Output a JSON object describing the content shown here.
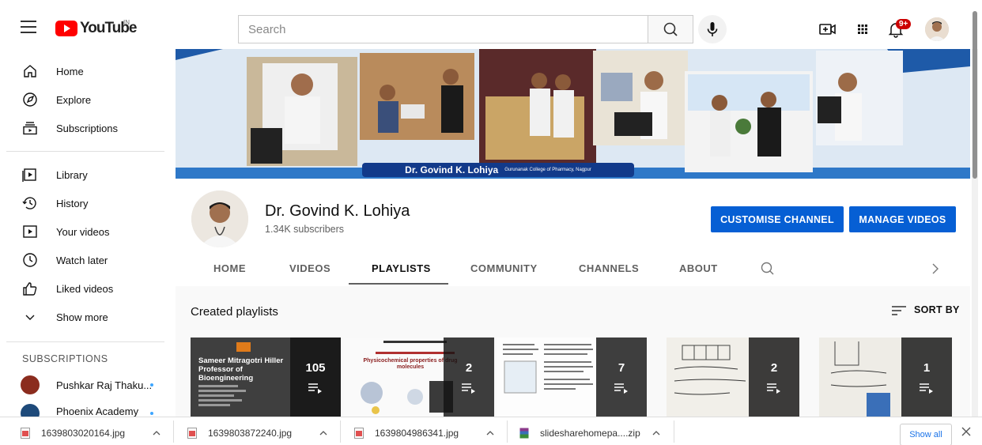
{
  "header": {
    "logo_text": "YouTube",
    "region": "IN",
    "search_placeholder": "Search",
    "notification_badge": "9+",
    "icons": [
      "menu-icon",
      "search-icon",
      "mic-icon",
      "create-video-icon",
      "apps-icon",
      "notifications-icon",
      "account-avatar"
    ]
  },
  "sidebar": {
    "main": [
      {
        "label": "Home",
        "icon": "home-icon"
      },
      {
        "label": "Explore",
        "icon": "explore-icon"
      },
      {
        "label": "Subscriptions",
        "icon": "subscriptions-icon"
      }
    ],
    "library": [
      {
        "label": "Library",
        "icon": "library-icon"
      },
      {
        "label": "History",
        "icon": "history-icon"
      },
      {
        "label": "Your videos",
        "icon": "your-videos-icon"
      },
      {
        "label": "Watch later",
        "icon": "watch-later-icon"
      },
      {
        "label": "Liked videos",
        "icon": "liked-videos-icon"
      },
      {
        "label": "Show more",
        "icon": "chevron-down-icon"
      }
    ],
    "subscriptions_heading": "SUBSCRIPTIONS",
    "subscriptions": [
      {
        "label": "Pushkar Raj Thaku...",
        "color": "#8b2c1e"
      },
      {
        "label": "Phoenix Academy",
        "color": "#1e4a7a"
      }
    ]
  },
  "banner": {
    "name": "Dr. Govind K. Lohiya",
    "sub": "Gurunanak College of Pharmacy, Nagpur"
  },
  "channel": {
    "name": "Dr. Govind K. Lohiya",
    "subscribers": "1.34K subscribers",
    "customise_label": "CUSTOMISE CHANNEL",
    "manage_label": "MANAGE VIDEOS",
    "accent": "#065fd4"
  },
  "tabs": [
    {
      "label": "HOME",
      "active": false
    },
    {
      "label": "VIDEOS",
      "active": false
    },
    {
      "label": "PLAYLISTS",
      "active": true
    },
    {
      "label": "COMMUNITY",
      "active": false
    },
    {
      "label": "CHANNELS",
      "active": false
    },
    {
      "label": "ABOUT",
      "active": false
    }
  ],
  "content": {
    "title": "Created playlists",
    "sort_label": "SORT BY",
    "playlists": [
      {
        "count": "105",
        "thumb_text": "Sameer Mitragotri Hiller Professor of Bioengineering"
      },
      {
        "count": "2",
        "thumb_text": "Physicochemical properties of drug molecules"
      },
      {
        "count": "7",
        "thumb_text": ""
      },
      {
        "count": "2",
        "thumb_text": ""
      },
      {
        "count": "1",
        "thumb_text": ""
      }
    ]
  },
  "downloads": {
    "items": [
      {
        "name": "1639803020164.jpg",
        "type": "image"
      },
      {
        "name": "1639803872240.jpg",
        "type": "image"
      },
      {
        "name": "1639804986341.jpg",
        "type": "image"
      },
      {
        "name": "slidesharehomepa....zip",
        "type": "archive"
      }
    ],
    "show_all": "Show all"
  }
}
